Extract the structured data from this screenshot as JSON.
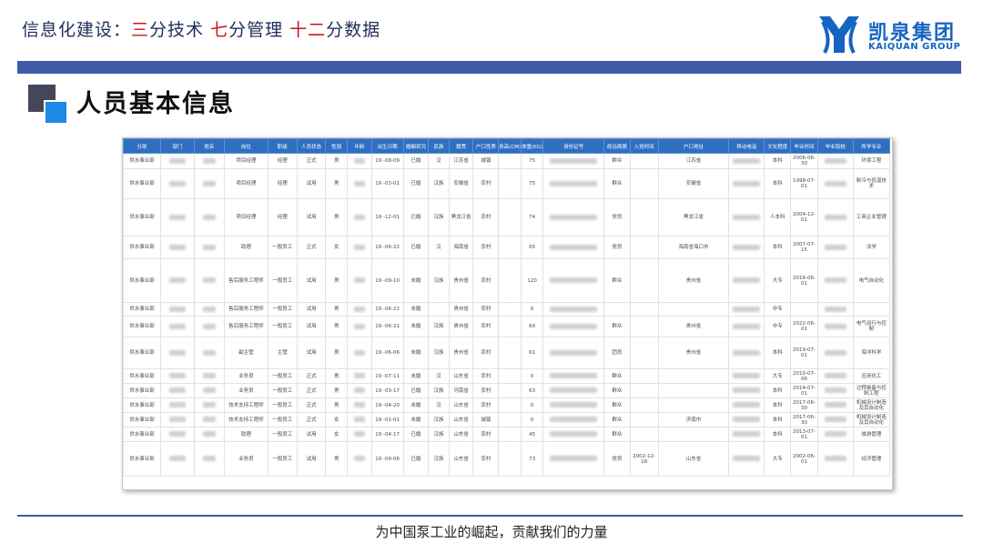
{
  "header": {
    "prefix": "信息化建设：",
    "p1_red": "三",
    "p1_rest": "分技术  ",
    "p2_red": "七",
    "p2_rest": "分管理  ",
    "p3_red": "十二",
    "p3_rest": "分数据"
  },
  "logo": {
    "name_cn": "凯泉集团",
    "name_en": "KAIQUAN GROUP"
  },
  "section": {
    "title": "人员基本信息"
  },
  "colors": {
    "bar": "#3e5aa8",
    "accent_red": "#c8161d",
    "table_header": "#2f6fbf",
    "brand_blue": "#1565c0"
  },
  "table": {
    "columns": [
      "分部",
      "部门",
      "姓名",
      "岗位",
      "职级",
      "人员状态",
      "性别",
      "年龄",
      "出生日期",
      "婚姻状况",
      "民族",
      "籍贯",
      "户口性质",
      "身高(CM)",
      "体重(KG)",
      "身份证号",
      "政治面貌",
      "入党时间",
      "户口地址",
      "移动电话",
      "文化程度",
      "毕业时间",
      "毕业院校",
      "所学专业"
    ],
    "rows": [
      {
        "c0": "供水事业部",
        "c3": "项目经理",
        "c4": "经理",
        "c5": "正式",
        "c6": "男",
        "c8": "19  -08-09",
        "c9": "已婚",
        "c10": "汉",
        "c11": "江苏省",
        "c12": "城镇",
        "c14": "75",
        "c16": "群众",
        "c18": "江苏省",
        "c20": "本科",
        "c21": "2006-06-30",
        "c23": "环境工程"
      },
      {
        "c0": "供水事业部",
        "c3": "项目经理",
        "c4": "经理",
        "c5": "试用",
        "c6": "男",
        "c8": "19  -03-01",
        "c9": "已婚",
        "c10": "汉族",
        "c11": "安徽省",
        "c12": "农村",
        "c14": "75",
        "c16": "群众",
        "c18": "安徽省",
        "c20": "本科",
        "c21": "1998-07-01",
        "c23": "制冷与低温技术"
      },
      {
        "c0": "供水事业部",
        "c3": "项目经理",
        "c4": "经理",
        "c5": "试用",
        "c6": "男",
        "c8": "19  -12-01",
        "c9": "已婚",
        "c10": "汉族",
        "c11": "黑龙江省",
        "c12": "农村",
        "c14": "74",
        "c16": "党员",
        "c18": "黑龙江省",
        "c20": "人本科",
        "c21": "2004-12-01",
        "c23": "工商企业管理"
      },
      {
        "c0": "供水事业部",
        "c3": "助理",
        "c4": "一般员工",
        "c5": "正式",
        "c6": "女",
        "c8": "19  -06-22",
        "c9": "已婚",
        "c10": "汉",
        "c11": "海南省",
        "c12": "农村",
        "c14": "65",
        "c16": "党员",
        "c18": "海南省海口市",
        "c20": "本科",
        "c21": "2007-07-15",
        "c23": "法学"
      },
      {
        "c0": "供水事业部",
        "c3": "售后服务工程师",
        "c4": "一般员工",
        "c5": "试用",
        "c6": "男",
        "c8": "19  -09-10",
        "c9": "未婚",
        "c10": "汉族",
        "c11": "贵州省",
        "c12": "农村",
        "c14": "120",
        "c16": "群众",
        "c18": "贵州省",
        "c20": "大专",
        "c21": "2016-06-01",
        "c23": "电气自动化"
      },
      {
        "c0": "供水事业部",
        "c3": "售后服务工程师",
        "c4": "一般员工",
        "c5": "试用",
        "c6": "男",
        "c8": "19  -06-22",
        "c9": "未婚",
        "c10": "",
        "c11": "贵州省",
        "c12": "农村",
        "c14": "0",
        "c16": "",
        "c18": "",
        "c20": "中专",
        "c21": "",
        "c23": ""
      },
      {
        "c0": "供水事业部",
        "c3": "售后服务工程师",
        "c4": "一般员工",
        "c5": "试用",
        "c6": "男",
        "c8": "19  -06-21",
        "c9": "未婚",
        "c10": "汉族",
        "c11": "贵州省",
        "c12": "农村",
        "c14": "60",
        "c16": "群众",
        "c18": "贵州省",
        "c20": "中专",
        "c21": "2022-06-01",
        "c23": "电气运行与控制"
      },
      {
        "c0": "供水事业部",
        "c3": "副主管",
        "c4": "主管",
        "c5": "试用",
        "c6": "男",
        "c8": "19  -06-06",
        "c9": "未婚",
        "c10": "汉族",
        "c11": "贵州省",
        "c12": "农村",
        "c14": "61",
        "c16": "团员",
        "c18": "贵州省",
        "c20": "本科",
        "c21": "2019-07-01",
        "c23": "海洋科学"
      },
      {
        "c0": "供水事业部",
        "c3": "业务员",
        "c4": "一般员工",
        "c5": "正式",
        "c6": "男",
        "c8": "19  -07-11",
        "c9": "未婚",
        "c10": "汉",
        "c11": "山东省",
        "c12": "农村",
        "c14": "0",
        "c16": "群众",
        "c18": "",
        "c20": "大专",
        "c21": "2010-07-06",
        "c23": "应用化工"
      },
      {
        "c0": "供水事业部",
        "c3": "业务员",
        "c4": "一般员工",
        "c5": "正式",
        "c6": "男",
        "c8": "19  -03-17",
        "c9": "已婚",
        "c10": "汉族",
        "c11": "河南省",
        "c12": "农村",
        "c14": "63",
        "c16": "群众",
        "c18": "",
        "c20": "本科",
        "c21": "2014-07-01",
        "c23": "过程装备与控制工程"
      },
      {
        "c0": "供水事业部",
        "c3": "技术支持工程师",
        "c4": "一般员工",
        "c5": "正式",
        "c6": "男",
        "c8": "19  -04-20",
        "c9": "未婚",
        "c10": "汉",
        "c11": "山东省",
        "c12": "农村",
        "c14": "0",
        "c16": "群众",
        "c18": "",
        "c20": "本科",
        "c21": "2017-06-30",
        "c23": "机械设计制造及其自动化"
      },
      {
        "c0": "供水事业部",
        "c3": "技术支持工程师",
        "c4": "一般员工",
        "c5": "正式",
        "c6": "女",
        "c8": "19  -01-01",
        "c9": "未婚",
        "c10": "汉族",
        "c11": "山东省",
        "c12": "城镇",
        "c14": "0",
        "c16": "群众",
        "c18": "济南市",
        "c20": "本科",
        "c21": "2017-06-30",
        "c23": "机械设计制造及其自动化"
      },
      {
        "c0": "供水事业部",
        "c3": "助理",
        "c4": "一般员工",
        "c5": "试用",
        "c6": "女",
        "c8": "19  -04-17",
        "c9": "已婚",
        "c10": "汉族",
        "c11": "山东省",
        "c12": "农村",
        "c14": "45",
        "c16": "群众",
        "c18": "",
        "c20": "本科",
        "c21": "2013-07-01",
        "c23": "旅游管理"
      },
      {
        "c0": "供水事业部",
        "c3": "业务员",
        "c4": "一般员工",
        "c5": "试用",
        "c6": "男",
        "c8": "19  -09-06",
        "c9": "已婚",
        "c10": "汉族",
        "c11": "山东省",
        "c12": "农村",
        "c14": "73",
        "c16": "党员",
        "c17": "2002-12-18",
        "c18": "山东省",
        "c20": "大专",
        "c21": "2002-06-01",
        "c23": "经济管理"
      }
    ]
  },
  "footer": {
    "slogan": "为中国泵工业的崛起，贡献我们的力量"
  }
}
